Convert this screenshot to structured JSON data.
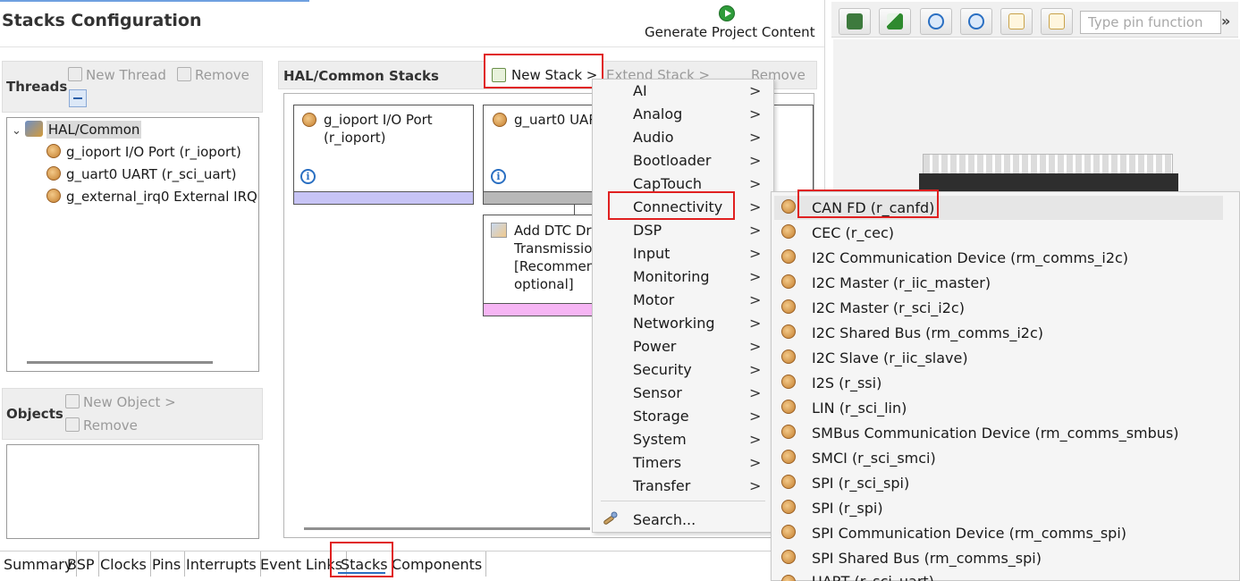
{
  "header": {
    "title": "Stacks Configuration",
    "generate_label": "Generate Project Content"
  },
  "pin_panel": {
    "search_placeholder": "Type pin function",
    "more": "»",
    "toolbar_icons": [
      "save-icon",
      "mountain-icon",
      "zoom-out-icon",
      "zoom-in-icon",
      "document-icon",
      "document-icon"
    ]
  },
  "threads": {
    "title": "Threads",
    "new_thread": "New Thread",
    "remove": "Remove",
    "root": "HAL/Common",
    "items": [
      "g_ioport I/O Port (r_ioport)",
      "g_uart0 UART (r_sci_uart)",
      "g_external_irq0 External IRQ ("
    ]
  },
  "objects": {
    "title": "Objects",
    "new_object": "New Object >",
    "remove": "Remove"
  },
  "stacks": {
    "title": "HAL/Common Stacks",
    "new_stack": "New Stack >",
    "extend_stack": "Extend Stack >",
    "remove": "Remove",
    "cards": {
      "ioport_line1": "g_ioport I/O Port",
      "ioport_line2": "(r_ioport)",
      "uart_line1": "g_uart0 UAR",
      "dtc_line1": "Add DTC Dr",
      "dtc_line2": "Transmissio",
      "dtc_line3": "[Recommen",
      "dtc_line4": "optional]",
      "info": "i"
    }
  },
  "menu_categories": {
    "items": [
      "AI",
      "Analog",
      "Audio",
      "Bootloader",
      "CapTouch",
      "Connectivity",
      "DSP",
      "Input",
      "Monitoring",
      "Motor",
      "Networking",
      "Power",
      "Security",
      "Sensor",
      "Storage",
      "System",
      "Timers",
      "Transfer"
    ],
    "arrow": ">",
    "search": "Search..."
  },
  "menu_connectivity": {
    "items": [
      "CAN FD (r_canfd)",
      "CEC (r_cec)",
      "I2C Communication Device (rm_comms_i2c)",
      "I2C Master (r_iic_master)",
      "I2C Master (r_sci_i2c)",
      "I2C Shared Bus (rm_comms_i2c)",
      "I2C Slave (r_iic_slave)",
      "I2S (r_ssi)",
      "LIN (r_sci_lin)",
      "SMBus Communication Device (rm_comms_smbus)",
      "SMCI (r_sci_smci)",
      "SPI (r_sci_spi)",
      "SPI (r_spi)",
      "SPI Communication Device (rm_comms_spi)",
      "SPI Shared Bus (rm_comms_spi)",
      "UART (r_sci_uart)"
    ]
  },
  "tabs": {
    "items": [
      "Summary",
      "BSP",
      "Clocks",
      "Pins",
      "Interrupts",
      "Event Links",
      "Stacks",
      "Components"
    ],
    "active": "Stacks"
  },
  "colors": {
    "highlight_red": "#e02020",
    "active_tab_underline": "#2a6fc2",
    "card_bar_blue": "#c7c4f5",
    "card_bar_pink": "#f6b5f4"
  }
}
